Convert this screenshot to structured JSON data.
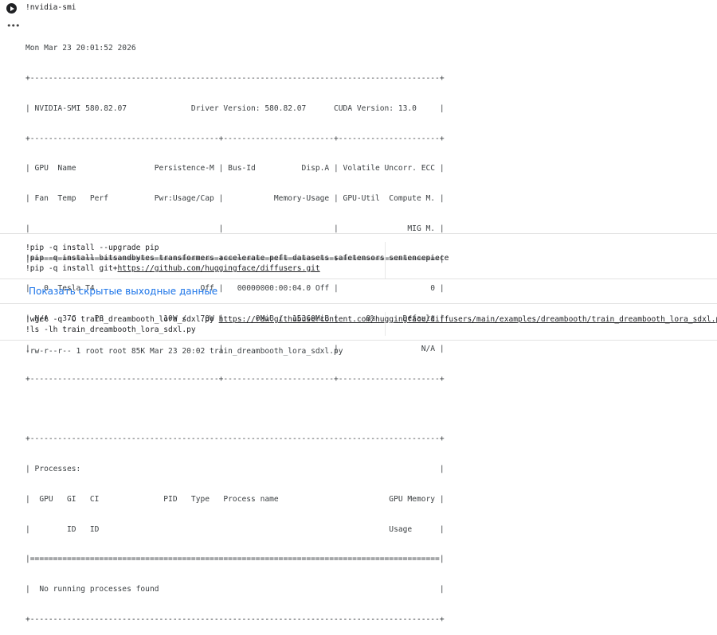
{
  "cell1": {
    "code": "!nvidia-smi",
    "output_lines": [
      "Mon Mar 23 20:01:52 2026",
      "+-----------------------------------------------------------------------------------------+",
      "| NVIDIA-SMI 580.82.07              Driver Version: 580.82.07      CUDA Version: 13.0     |",
      "+-----------------------------------------+------------------------+----------------------+",
      "| GPU  Name                 Persistence-M | Bus-Id          Disp.A | Volatile Uncorr. ECC |",
      "| Fan  Temp   Perf          Pwr:Usage/Cap |           Memory-Usage | GPU-Util  Compute M. |",
      "|                                         |                        |               MIG M. |",
      "|=========================================+========================+======================|",
      "|   0  Tesla T4                       Off |   00000000:00:04.0 Off |                    0 |",
      "| N/A   37C    P8             10W /   70W |       0MiB /  15360MiB |      0%      Default |",
      "|                                         |                        |                  N/A |",
      "+-----------------------------------------+------------------------+----------------------+",
      "",
      "+-----------------------------------------------------------------------------------------+",
      "| Processes:                                                                              |",
      "|  GPU   GI   CI              PID   Type   Process name                        GPU Memory |",
      "|        ID   ID                                                               Usage      |",
      "|=========================================================================================|",
      "|  No running processes found                                                             |",
      "+-----------------------------------------------------------------------------------------+"
    ]
  },
  "cell2": {
    "line1": "!pip -q install --upgrade pip",
    "line2": "!pip -q install bitsandbytes transformers accelerate peft datasets safetensors sentencepiece",
    "line3_prefix": "!pip -q install git+",
    "line3_url": "https://github.com/huggingface/diffusers.git",
    "show_hidden_output": "Показать скрытые выходные данные"
  },
  "cell3": {
    "line1_prefix": "!wget -q -O train_dreambooth_lora_sdxl.py ",
    "line1_url": "https://raw.githubusercontent.com/huggingface/diffusers/main/examples/dreambooth/train_dreambooth_lora_sdxl.py",
    "line2": "!ls -lh train_dreambooth_lora_sdxl.py",
    "output": "-rw-r--r-- 1 root root 85K Mar 23 20:02 train_dreambooth_lora_sdxl.py"
  },
  "icons": {
    "run": "play-circle-icon",
    "menu": "more-horiz-icon"
  }
}
